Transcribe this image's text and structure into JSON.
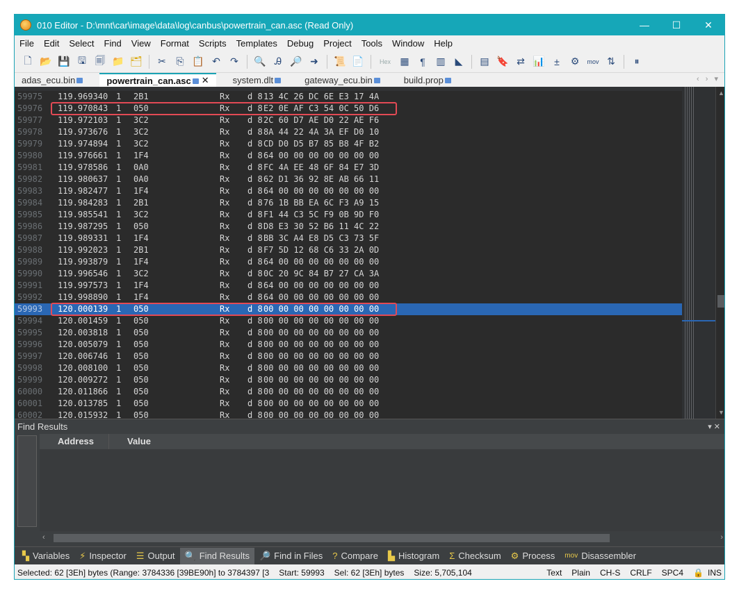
{
  "window": {
    "title": "010 Editor - D:\\mnt\\car\\image\\data\\log\\canbus\\powertrain_can.asc (Read Only)",
    "minimize": "—",
    "maximize": "☐",
    "close": "✕"
  },
  "menu": [
    "File",
    "Edit",
    "Select",
    "Find",
    "View",
    "Format",
    "Scripts",
    "Templates",
    "Debug",
    "Project",
    "Tools",
    "Window",
    "Help"
  ],
  "toolbar": {
    "hex_label": "Hex",
    "mov_label": "mov"
  },
  "tabs": [
    {
      "label": "adas_ecu.bin",
      "active": false
    },
    {
      "label": "powertrain_can.asc",
      "active": true
    },
    {
      "label": "system.dlt",
      "active": false
    },
    {
      "label": "gateway_ecu.bin",
      "active": false
    },
    {
      "label": "build.prop",
      "active": false
    }
  ],
  "tab_close": "✕",
  "log_lines": [
    {
      "n": "59975",
      "ts": "119.969340",
      "ch": "1",
      "id": "2B1",
      "dir": "Rx",
      "dlc": "d 8",
      "data": "13 4C 26 DC 6E E3 17 4A"
    },
    {
      "n": "59976",
      "ts": "119.970843",
      "ch": "1",
      "id": "050",
      "dir": "Rx",
      "dlc": "d 8",
      "data": "E2 0E AF C3 54 0C 50 D6"
    },
    {
      "n": "59977",
      "ts": "119.972103",
      "ch": "1",
      "id": "3C2",
      "dir": "Rx",
      "dlc": "d 8",
      "data": "2C 60 D7 AE D0 22 AE F6"
    },
    {
      "n": "59978",
      "ts": "119.973676",
      "ch": "1",
      "id": "3C2",
      "dir": "Rx",
      "dlc": "d 8",
      "data": "8A 44 22 4A 3A EF D0 10"
    },
    {
      "n": "59979",
      "ts": "119.974894",
      "ch": "1",
      "id": "3C2",
      "dir": "Rx",
      "dlc": "d 8",
      "data": "CD D0 D5 B7 85 B8 4F B2"
    },
    {
      "n": "59980",
      "ts": "119.976661",
      "ch": "1",
      "id": "1F4",
      "dir": "Rx",
      "dlc": "d 8",
      "data": "64 00 00 00 00 00 00 00"
    },
    {
      "n": "59981",
      "ts": "119.978586",
      "ch": "1",
      "id": "0A0",
      "dir": "Rx",
      "dlc": "d 8",
      "data": "FC 4A EE 48 6F 84 E7 3D"
    },
    {
      "n": "59982",
      "ts": "119.980637",
      "ch": "1",
      "id": "0A0",
      "dir": "Rx",
      "dlc": "d 8",
      "data": "62 D1 36 92 8E AB 66 11"
    },
    {
      "n": "59983",
      "ts": "119.982477",
      "ch": "1",
      "id": "1F4",
      "dir": "Rx",
      "dlc": "d 8",
      "data": "64 00 00 00 00 00 00 00"
    },
    {
      "n": "59984",
      "ts": "119.984283",
      "ch": "1",
      "id": "2B1",
      "dir": "Rx",
      "dlc": "d 8",
      "data": "76 1B BB EA 6C F3 A9 15"
    },
    {
      "n": "59985",
      "ts": "119.985541",
      "ch": "1",
      "id": "3C2",
      "dir": "Rx",
      "dlc": "d 8",
      "data": "F1 44 C3 5C F9 0B 9D F0"
    },
    {
      "n": "59986",
      "ts": "119.987295",
      "ch": "1",
      "id": "050",
      "dir": "Rx",
      "dlc": "d 8",
      "data": "D8 E3 30 52 B6 11 4C 22"
    },
    {
      "n": "59987",
      "ts": "119.989331",
      "ch": "1",
      "id": "1F4",
      "dir": "Rx",
      "dlc": "d 8",
      "data": "BB 3C A4 E8 D5 C3 73 5F"
    },
    {
      "n": "59988",
      "ts": "119.992023",
      "ch": "1",
      "id": "2B1",
      "dir": "Rx",
      "dlc": "d 8",
      "data": "F7 5D 12 68 C6 33 2A 0D"
    },
    {
      "n": "59989",
      "ts": "119.993879",
      "ch": "1",
      "id": "1F4",
      "dir": "Rx",
      "dlc": "d 8",
      "data": "64 00 00 00 00 00 00 00"
    },
    {
      "n": "59990",
      "ts": "119.996546",
      "ch": "1",
      "id": "3C2",
      "dir": "Rx",
      "dlc": "d 8",
      "data": "0C 20 9C 84 B7 27 CA 3A"
    },
    {
      "n": "59991",
      "ts": "119.997573",
      "ch": "1",
      "id": "1F4",
      "dir": "Rx",
      "dlc": "d 8",
      "data": "64 00 00 00 00 00 00 00"
    },
    {
      "n": "59992",
      "ts": "119.998890",
      "ch": "1",
      "id": "1F4",
      "dir": "Rx",
      "dlc": "d 8",
      "data": "64 00 00 00 00 00 00 00"
    },
    {
      "n": "59993",
      "ts": "120.000139",
      "ch": "1",
      "id": "050",
      "dir": "Rx",
      "dlc": "d 8",
      "data": "00 00 00 00 00 00 00 00",
      "selected": true
    },
    {
      "n": "59994",
      "ts": "120.001459",
      "ch": "1",
      "id": "050",
      "dir": "Rx",
      "dlc": "d 8",
      "data": "00 00 00 00 00 00 00 00"
    },
    {
      "n": "59995",
      "ts": "120.003818",
      "ch": "1",
      "id": "050",
      "dir": "Rx",
      "dlc": "d 8",
      "data": "00 00 00 00 00 00 00 00"
    },
    {
      "n": "59996",
      "ts": "120.005079",
      "ch": "1",
      "id": "050",
      "dir": "Rx",
      "dlc": "d 8",
      "data": "00 00 00 00 00 00 00 00"
    },
    {
      "n": "59997",
      "ts": "120.006746",
      "ch": "1",
      "id": "050",
      "dir": "Rx",
      "dlc": "d 8",
      "data": "00 00 00 00 00 00 00 00"
    },
    {
      "n": "59998",
      "ts": "120.008100",
      "ch": "1",
      "id": "050",
      "dir": "Rx",
      "dlc": "d 8",
      "data": "00 00 00 00 00 00 00 00"
    },
    {
      "n": "59999",
      "ts": "120.009272",
      "ch": "1",
      "id": "050",
      "dir": "Rx",
      "dlc": "d 8",
      "data": "00 00 00 00 00 00 00 00"
    },
    {
      "n": "60000",
      "ts": "120.011866",
      "ch": "1",
      "id": "050",
      "dir": "Rx",
      "dlc": "d 8",
      "data": "00 00 00 00 00 00 00 00"
    },
    {
      "n": "60001",
      "ts": "120.013785",
      "ch": "1",
      "id": "050",
      "dir": "Rx",
      "dlc": "d 8",
      "data": "00 00 00 00 00 00 00 00"
    },
    {
      "n": "60002",
      "ts": "120.015932",
      "ch": "1",
      "id": "050",
      "dir": "Rx",
      "dlc": "d 8",
      "data": "00 00 00 00 00 00 00 00"
    }
  ],
  "find_results": {
    "title": "Find Results",
    "col_address": "Address",
    "col_value": "Value",
    "ctrls": "▾ ✕"
  },
  "bottom_tabs": [
    {
      "label": "Variables",
      "icon": "variables-icon",
      "glyph": "▚"
    },
    {
      "label": "Inspector",
      "icon": "lightning-icon",
      "glyph": "⚡"
    },
    {
      "label": "Output",
      "icon": "output-icon",
      "glyph": "☰"
    },
    {
      "label": "Find Results",
      "icon": "find-icon",
      "glyph": "🔍",
      "active": true
    },
    {
      "label": "Find in Files",
      "icon": "find-in-files-icon",
      "glyph": "🔎"
    },
    {
      "label": "Compare",
      "icon": "compare-icon",
      "glyph": "?"
    },
    {
      "label": "Histogram",
      "icon": "histogram-icon",
      "glyph": "▙"
    },
    {
      "label": "Checksum",
      "icon": "checksum-icon",
      "glyph": "Σ"
    },
    {
      "label": "Process",
      "icon": "process-icon",
      "glyph": "⚙"
    },
    {
      "label": "Disassembler",
      "icon": "disassembler-icon",
      "glyph": "mov"
    }
  ],
  "status": {
    "selected": "Selected: 62 [3Eh] bytes (Range: 3784336 [39BE90h] to 3784397 [3",
    "start": "Start: 59993",
    "sel": "Sel: 62 [3Eh] bytes",
    "size": "Size: 5,705,104",
    "text": "Text",
    "plain": "Plain",
    "charset": "CH-S",
    "eol": "CRLF",
    "spc": "SPC4",
    "ins": "INS"
  }
}
